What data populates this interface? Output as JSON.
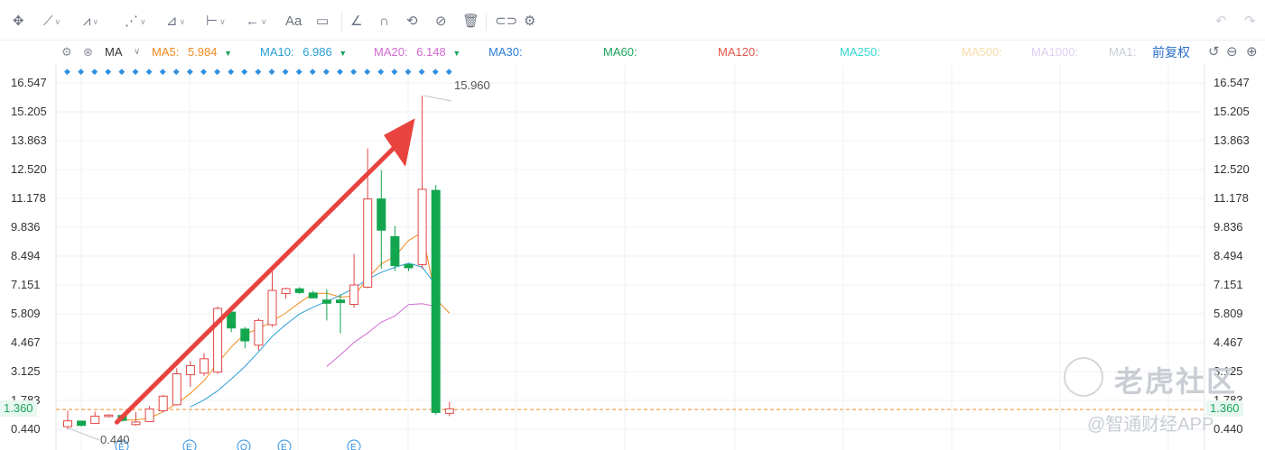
{
  "toolbar": {
    "tools": [
      {
        "name": "move-icon",
        "glyph": "✥"
      },
      {
        "name": "line-tool-icon",
        "glyph": "⟋",
        "dropdown": true
      },
      {
        "name": "channel-tool-icon",
        "glyph": "⩘",
        "dropdown": true
      },
      {
        "name": "zigzag-tool-icon",
        "glyph": "⋰",
        "dropdown": true
      },
      {
        "name": "fib-tool-icon",
        "glyph": "⊿",
        "dropdown": true
      },
      {
        "name": "measure-tool-icon",
        "glyph": "⊢",
        "dropdown": true
      },
      {
        "name": "arrow-tool-icon",
        "glyph": "←",
        "dropdown": true
      },
      {
        "name": "text-tool-icon",
        "glyph": "Aa"
      },
      {
        "name": "note-tool-icon",
        "glyph": "▭"
      },
      {
        "name": "eraser-icon",
        "glyph": "∠"
      },
      {
        "name": "magnet-icon",
        "glyph": "∩"
      },
      {
        "name": "sync-icon",
        "glyph": "⟲"
      },
      {
        "name": "hide-icon",
        "glyph": "⊘"
      },
      {
        "name": "trash-icon",
        "glyph": "🗑"
      },
      {
        "name": "compare-icon",
        "glyph": "⊂⊃"
      },
      {
        "name": "settings-icon",
        "glyph": "⚙"
      }
    ],
    "undo_glyph": "↶",
    "redo_glyph": "↷"
  },
  "indicators": {
    "name": "MA",
    "items": [
      {
        "label": "MA5:",
        "value": "5.984",
        "color": "#f08c1e",
        "arrow": "▼",
        "arrow_color": "#1aa55c"
      },
      {
        "label": "MA10:",
        "value": "6.986",
        "color": "#2a9fd6",
        "arrow": "▼",
        "arrow_color": "#1aa55c"
      },
      {
        "label": "MA20:",
        "value": "6.148",
        "color": "#d26ad2",
        "arrow": "▼",
        "arrow_color": "#1aa55c"
      },
      {
        "label": "MA30:",
        "value": "",
        "color": "#2a7fd6"
      },
      {
        "label": "MA60:",
        "value": "",
        "color": "#1aa55c"
      },
      {
        "label": "MA120:",
        "value": "",
        "color": "#e0564a"
      },
      {
        "label": "MA250:",
        "value": "",
        "color": "#38d6d0"
      },
      {
        "label": "MA500:",
        "value": "",
        "color": "#f7dca8"
      },
      {
        "label": "MA1000:",
        "value": "",
        "color": "#ddd0f2"
      },
      {
        "label": "MA1:",
        "value": "",
        "color": "#d6d9de"
      }
    ],
    "adjust_label": "前复权"
  },
  "chart_data": {
    "type": "candlestick",
    "y_ticks": [
      "16.547",
      "15.205",
      "13.863",
      "12.520",
      "11.178",
      "9.836",
      "8.494",
      "7.151",
      "5.809",
      "4.467",
      "3.125",
      "1.783",
      "0.440"
    ],
    "ylim": [
      0.44,
      16.547
    ],
    "current_price": "1.360",
    "current_price_value": 1.36,
    "high_label": "15.960",
    "low_label": "0.440",
    "candles": [
      {
        "o": 0.56,
        "h": 1.3,
        "l": 0.44,
        "c": 0.83
      },
      {
        "o": 0.82,
        "h": 0.84,
        "l": 0.57,
        "c": 0.62
      },
      {
        "o": 0.71,
        "h": 1.26,
        "l": 0.7,
        "c": 1.05
      },
      {
        "o": 1.03,
        "h": 1.14,
        "l": 0.98,
        "c": 1.1
      },
      {
        "o": 1.08,
        "h": 1.12,
        "l": 0.8,
        "c": 0.85
      },
      {
        "o": 0.66,
        "h": 1.23,
        "l": 0.6,
        "c": 0.78
      },
      {
        "o": 0.8,
        "h": 1.52,
        "l": 0.78,
        "c": 1.38
      },
      {
        "o": 1.3,
        "h": 2.05,
        "l": 1.24,
        "c": 1.98
      },
      {
        "o": 1.58,
        "h": 3.28,
        "l": 1.55,
        "c": 3.02
      },
      {
        "o": 2.98,
        "h": 3.62,
        "l": 2.42,
        "c": 3.4
      },
      {
        "o": 3.05,
        "h": 3.98,
        "l": 2.92,
        "c": 3.72
      },
      {
        "o": 3.1,
        "h": 6.15,
        "l": 3.02,
        "c": 6.06
      },
      {
        "o": 5.89,
        "h": 5.92,
        "l": 4.96,
        "c": 5.15
      },
      {
        "o": 5.1,
        "h": 5.2,
        "l": 4.2,
        "c": 4.55
      },
      {
        "o": 4.35,
        "h": 5.6,
        "l": 4.1,
        "c": 5.5
      },
      {
        "o": 5.3,
        "h": 8.05,
        "l": 5.2,
        "c": 6.9
      },
      {
        "o": 6.75,
        "h": 7.03,
        "l": 6.51,
        "c": 6.98
      },
      {
        "o": 6.97,
        "h": 7.05,
        "l": 6.74,
        "c": 6.8
      },
      {
        "o": 6.78,
        "h": 6.89,
        "l": 6.58,
        "c": 6.55
      },
      {
        "o": 6.45,
        "h": 6.95,
        "l": 5.5,
        "c": 6.3
      },
      {
        "o": 6.45,
        "h": 6.72,
        "l": 4.9,
        "c": 6.33
      },
      {
        "o": 6.25,
        "h": 8.6,
        "l": 6.1,
        "c": 7.15
      },
      {
        "o": 7.05,
        "h": 13.5,
        "l": 7.0,
        "c": 11.15
      },
      {
        "o": 11.15,
        "h": 12.5,
        "l": 7.9,
        "c": 9.7
      },
      {
        "o": 9.4,
        "h": 9.9,
        "l": 7.8,
        "c": 8.05
      },
      {
        "o": 8.1,
        "h": 8.15,
        "l": 7.8,
        "c": 7.95
      },
      {
        "o": 8.1,
        "h": 15.96,
        "l": 7.9,
        "c": 11.6
      },
      {
        "o": 11.55,
        "h": 11.8,
        "l": 1.12,
        "c": 1.22
      },
      {
        "o": 1.18,
        "h": 1.72,
        "l": 1.05,
        "c": 1.39
      }
    ],
    "ma5": [
      null,
      null,
      null,
      null,
      0.86,
      0.88,
      0.95,
      1.26,
      1.63,
      2.11,
      2.7,
      3.52,
      4.27,
      4.88,
      5.1,
      5.47,
      5.85,
      6.33,
      6.75,
      6.77,
      6.59,
      6.63,
      7.47,
      8.13,
      8.48,
      9.22,
      9.6,
      6.5,
      5.84
    ],
    "ma10": [
      null,
      null,
      null,
      null,
      null,
      null,
      null,
      null,
      null,
      1.48,
      1.8,
      2.23,
      2.78,
      3.36,
      4.04,
      4.76,
      5.31,
      5.8,
      6.12,
      6.39,
      6.67,
      7.0,
      7.42,
      7.74,
      7.97,
      8.17,
      7.98,
      7.14
    ],
    "ma20": [
      null,
      null,
      null,
      null,
      null,
      null,
      null,
      null,
      null,
      null,
      null,
      null,
      null,
      null,
      null,
      null,
      null,
      null,
      null,
      3.36,
      3.9,
      4.48,
      4.92,
      5.42,
      5.71,
      6.24,
      6.28,
      6.15
    ],
    "event_markers": [
      "E",
      "E",
      "Q",
      "E",
      "E"
    ]
  },
  "annotations": {
    "marker_dots": "◆",
    "watermark_1": "老虎社区",
    "watermark_2": "@智通财经APP"
  },
  "colors": {
    "up": "#e04545",
    "down": "#12a64f",
    "grid": "#eef1f4",
    "arrow": "#e8433f",
    "current": "#f08c1e"
  },
  "right_controls": {
    "back": "↺",
    "zoom_out": "⊖",
    "zoom_in": "⊕"
  }
}
